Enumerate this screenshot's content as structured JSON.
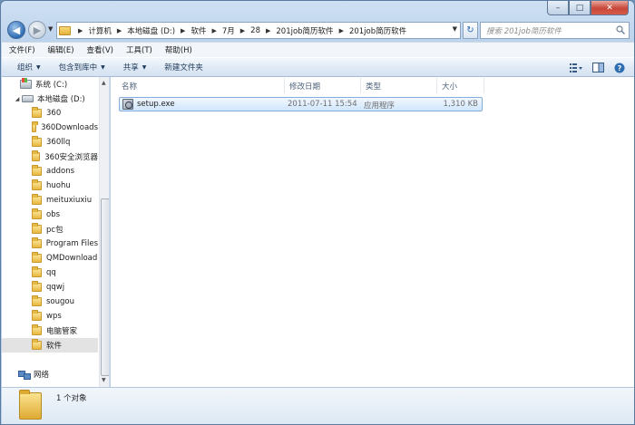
{
  "caption": {
    "min": "–",
    "max": "□",
    "close": "✕"
  },
  "nav": {
    "back_icon": "left-arrow-icon",
    "forward_icon": "right-arrow-icon"
  },
  "address": {
    "breadcrumbs": [
      "计算机",
      "本地磁盘 (D:)",
      "软件",
      "7月",
      "28",
      "201job简历软件",
      "201job简历软件"
    ]
  },
  "search": {
    "placeholder": "搜索 201job简历软件"
  },
  "menu": [
    "文件(F)",
    "编辑(E)",
    "查看(V)",
    "工具(T)",
    "帮助(H)"
  ],
  "commands": {
    "organize": "组织",
    "include_library": "包含到库中",
    "share": "共享",
    "new_folder": "新建文件夹"
  },
  "tree": {
    "system_drive": "系统 (C:)",
    "local_drive": "本地磁盘 (D:)",
    "folders": [
      "360",
      "360Downloads",
      "360llq",
      "360安全浏览器",
      "addons",
      "huohu",
      "meituxiuxiu",
      "obs",
      "pc包",
      "Program Files",
      "QMDownload",
      "qq",
      "qqwj",
      "sougou",
      "wps",
      "电脑管家",
      "软件"
    ],
    "selected_folder": "软件",
    "network": "网络"
  },
  "columns": {
    "name": "名称",
    "modified": "修改日期",
    "type": "类型",
    "size": "大小"
  },
  "files": [
    {
      "name": "setup.exe",
      "modified": "2011-07-11 15:54",
      "type": "应用程序",
      "size": "1,310 KB"
    }
  ],
  "status": {
    "count_text": "1 个对象"
  }
}
